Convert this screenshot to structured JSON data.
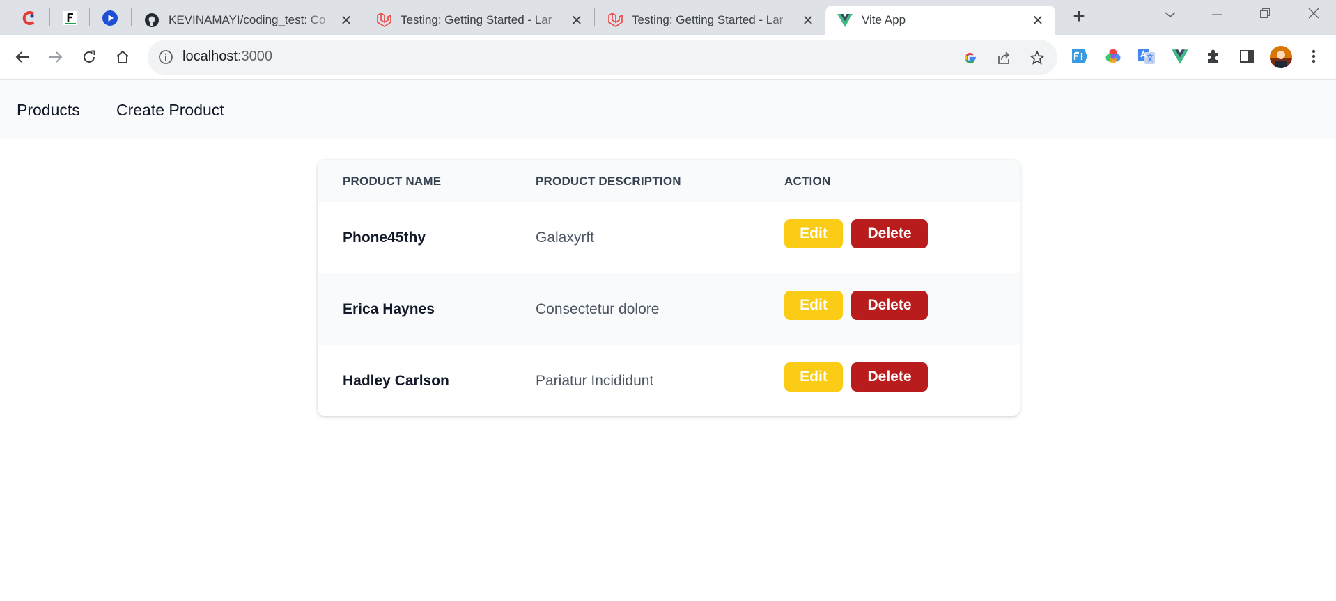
{
  "browser": {
    "tabs": [
      {
        "title": "KEVINAMAYI/coding_test: Co",
        "icon": "github-icon"
      },
      {
        "title": "Testing: Getting Started - Lar",
        "icon": "laravel-icon"
      },
      {
        "title": "Testing: Getting Started - Lar",
        "icon": "laravel-icon"
      },
      {
        "title": "Vite App",
        "icon": "vue-icon",
        "active": true
      }
    ],
    "close_glyph": "✕",
    "new_tab_glyph": "+",
    "address": {
      "host": "localhost",
      "port": ":3000"
    }
  },
  "app": {
    "nav": {
      "products": "Products",
      "create_product": "Create Product"
    },
    "table": {
      "headers": [
        "PRODUCT NAME",
        "PRODUCT DESCRIPTION",
        "ACTION"
      ],
      "rows": [
        {
          "name": "Phone45thy",
          "description": "Galaxyrft"
        },
        {
          "name": "Erica Haynes",
          "description": "Consectetur dolore"
        },
        {
          "name": "Hadley Carlson",
          "description": "Pariatur Incididunt"
        }
      ],
      "edit_label": "Edit",
      "delete_label": "Delete"
    }
  },
  "colors": {
    "edit_button": "#facc15",
    "delete_button": "#b91c1c",
    "nav_background": "#f8fafc"
  }
}
